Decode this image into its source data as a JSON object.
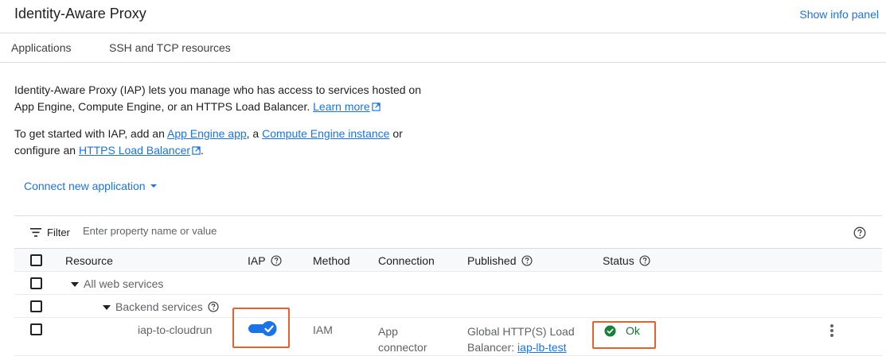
{
  "header": {
    "title": "Identity-Aware Proxy",
    "info_panel_label": "Show info panel"
  },
  "tabs": [
    {
      "label": "Applications"
    },
    {
      "label": "SSH and TCP resources"
    }
  ],
  "intro": {
    "line1": "Identity-Aware Proxy (IAP) lets you manage who has access to services hosted on",
    "line2_prefix": "App Engine, Compute Engine, or an HTTPS Load Balancer.",
    "learn_more": "Learn more",
    "line3_prefix": "To get started with IAP, add an",
    "app_engine_link": "App Engine app",
    "line3_mid": ", a",
    "compute_engine_link": "Compute Engine instance",
    "line3_suffix": "or",
    "line4_prefix": "configure an",
    "https_lb_link": "HTTPS Load Balancer",
    "line4_suffix": "."
  },
  "connect_button": "Connect new application",
  "filter": {
    "label": "Filter",
    "placeholder": "Enter property name or value"
  },
  "table": {
    "columns": {
      "resource": "Resource",
      "iap": "IAP",
      "method": "Method",
      "connection": "Connection",
      "published": "Published",
      "status": "Status"
    },
    "rows": [
      {
        "resource": "All web services"
      },
      {
        "resource": "Backend services"
      },
      {
        "resource": "iap-to-cloudrun",
        "iap_enabled": true,
        "method": "IAM",
        "connection_line1": "App",
        "connection_line2": "connector",
        "published_line1": "Global HTTP(S) Load",
        "published_line2_prefix": "Balancer:",
        "published_link": "iap-lb-test",
        "status": "Ok"
      }
    ]
  },
  "colors": {
    "accent": "#1a73e8",
    "toggle": "#1a73e8",
    "status_ok": "#137333",
    "highlight": "#e8602c"
  }
}
